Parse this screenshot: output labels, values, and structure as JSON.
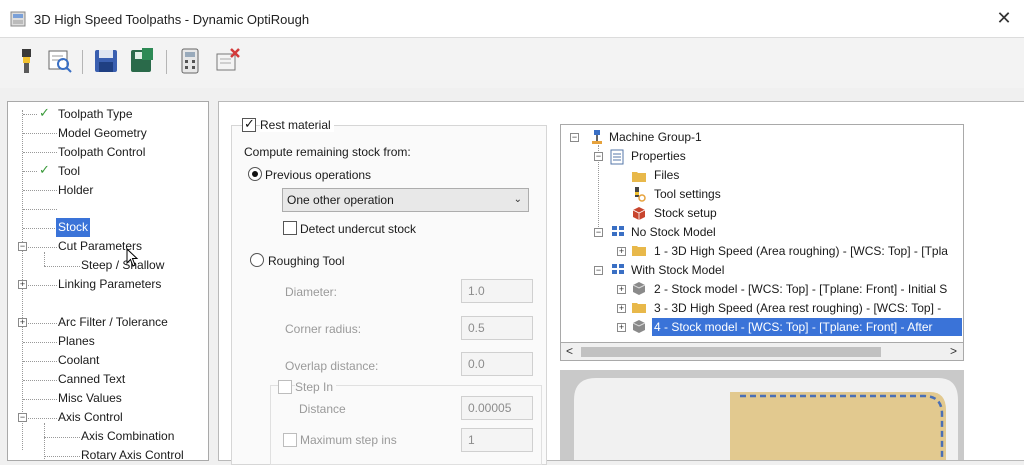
{
  "window": {
    "title": "3D High Speed Toolpaths - Dynamic OptiRough",
    "close_glyph": "✕"
  },
  "toolbar": {
    "buttons": [
      "tool-icon",
      "preview-icon",
      "save-icon",
      "save-all-icon",
      "calculator-icon",
      "delete-icon"
    ]
  },
  "nav_tree": {
    "items": [
      {
        "label": "Toolpath Type",
        "checked": true
      },
      {
        "label": "Model Geometry",
        "checked": false
      },
      {
        "label": "Toolpath Control",
        "checked": false
      },
      {
        "label": "Tool",
        "checked": true
      },
      {
        "label": "Holder",
        "checked": false
      },
      {
        "label": "Stock",
        "checked": false,
        "selected": true
      },
      {
        "label": "Cut Parameters",
        "expander": "−"
      },
      {
        "label": "Steep / Shallow",
        "indent": true
      },
      {
        "label": "Linking Parameters",
        "expander": "+"
      },
      {
        "label": "Arc Filter / Tolerance",
        "expander": "+"
      },
      {
        "label": "Planes"
      },
      {
        "label": "Coolant"
      },
      {
        "label": "Canned Text"
      },
      {
        "label": "Misc Values"
      },
      {
        "label": "Axis Control",
        "expander": "−"
      },
      {
        "label": "Axis Combination",
        "indent": true
      },
      {
        "label": "Rotary Axis Control",
        "indent": true
      }
    ]
  },
  "stock": {
    "rest_material_label": "Rest material",
    "rest_material_checked": true,
    "compute_from_label": "Compute remaining stock from:",
    "previous_ops_label": "Previous operations",
    "previous_ops_selected": true,
    "operation_select_value": "One other operation",
    "detect_undercut_label": "Detect undercut stock",
    "roughing_tool_label": "Roughing Tool",
    "diameter_label": "Diameter:",
    "diameter_value": "1.0",
    "corner_radius_label": "Corner radius:",
    "corner_radius_value": "0.5",
    "overlap_label": "Overlap distance:",
    "overlap_value": "0.0",
    "step_in_label": "Step In",
    "distance_label": "Distance",
    "distance_value": "0.00005",
    "max_step_label": "Maximum step ins",
    "max_step_value": "1"
  },
  "ops_tree": {
    "rows": [
      {
        "label": "Machine Group-1"
      },
      {
        "label": "Properties"
      },
      {
        "label": "Files"
      },
      {
        "label": "Tool settings"
      },
      {
        "label": "Stock setup"
      },
      {
        "label": "No Stock Model"
      },
      {
        "label": "1 - 3D High Speed (Area roughing) - [WCS: Top] - [Tpla"
      },
      {
        "label": "With Stock Model"
      },
      {
        "label": "2 - Stock model - [WCS: Top] - [Tplane: Front] - Initial S"
      },
      {
        "label": "3 - 3D High Speed (Area rest roughing) - [WCS: Top] -"
      },
      {
        "label": "4 - Stock model - [WCS: Top] - [Tplane: Front] - After",
        "selected": true
      }
    ],
    "scroll_left": "<",
    "scroll_right": ">"
  },
  "colors": {
    "selection": "#3a73d8",
    "check": "#3a9a3a",
    "folder": "#e8b84a"
  }
}
